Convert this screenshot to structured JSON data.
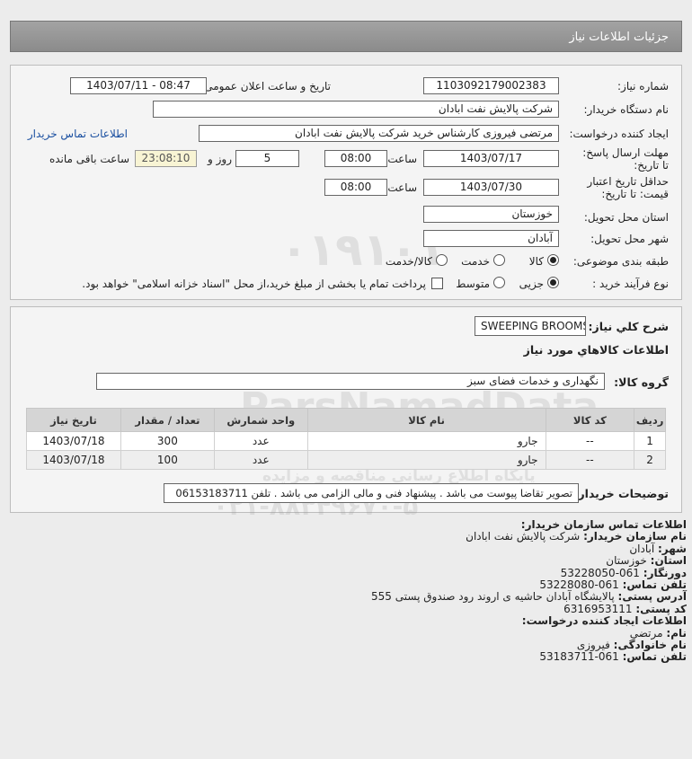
{
  "header": {
    "title": "جزئیات اطلاعات نیاز"
  },
  "form": {
    "need_number_label": "شماره نیاز:",
    "need_number": "1103092179002383",
    "announce_label": "تاریخ و ساعت اعلان عمومی:",
    "announce_value": "1403/07/11 - 08:47",
    "buyer_org_label": "نام دستگاه خریدار:",
    "buyer_org": "شرکت پالایش نفت ابادان",
    "creator_label": "ایجاد کننده درخواست:",
    "creator": "مرتضی فیروزی کارشناس خرید  شرکت پالایش نفت ابادان",
    "contact_link": "اطلاعات تماس خریدار",
    "deadline_label": "مهلت ارسال پاسخ: تا تاریخ:",
    "deadline_date": "1403/07/17",
    "time_label": "ساعت",
    "deadline_time": "08:00",
    "days": "5",
    "days_label": "روز و",
    "timer": "23:08:10",
    "remaining_label": "ساعت باقی مانده",
    "validity_label": "حداقل تاریخ اعتبار قیمت: تا تاریخ:",
    "validity_date": "1403/07/30",
    "validity_time": "08:00",
    "province_label": "استان محل تحویل:",
    "province": "خوزستان",
    "city_label": "شهر محل تحویل:",
    "city": "آبادان",
    "category_label": "طبقه بندی موضوعی:",
    "cat_goods": "کالا",
    "cat_service": "خدمت",
    "cat_both": "کالا/خدمت",
    "process_label": "نوع فرآیند خرید :",
    "proc_small": "جزیی",
    "proc_medium": "متوسط",
    "payment_note": "پرداخت تمام یا بخشی از مبلغ خرید،از محل \"اسناد خزانه اسلامی\" خواهد بود."
  },
  "details": {
    "general_desc_label": "شرح کلي نياز:",
    "general_desc": "SWEEPING BROOMS",
    "goods_info_title": "اطلاعات کالاهاي مورد نياز",
    "group_label": "گروه کالا:",
    "group_value": "نگهداری و خدمات فضای سبز",
    "table": {
      "headers": [
        "ردیف",
        "کد کالا",
        "نام کالا",
        "واحد شمارش",
        "تعداد / مقدار",
        "تاریخ نیاز"
      ],
      "rows": [
        [
          "1",
          "--",
          "جارو",
          "عدد",
          "300",
          "1403/07/18"
        ],
        [
          "2",
          "--",
          "جارو",
          "عدد",
          "100",
          "1403/07/18"
        ]
      ]
    },
    "buyer_notes_label": "توضیحات خریدار:",
    "buyer_notes": "تصویر تقاضا پیوست می باشد . پیشنهاد فنی و مالی الزامی می باشد . تلفن 06153183711"
  },
  "contact": {
    "title": "اطلاعات تماس سازمان خریدار:",
    "org_label": "نام سازمان خریدار:",
    "org": "شرکت پالایش نفت ابادان",
    "city_label": "شهر:",
    "city": "آبادان",
    "province_label": "استان:",
    "province": "خوزستان",
    "fax_label": "دورنگار:",
    "fax": "061-53228050",
    "phone_label": "تلفن تماس:",
    "phone": "061-53228080",
    "address_label": "آدرس پستی:",
    "address": "پالایشگاه آبادان حاشیه ی اروند رود صندوق پستی 555",
    "postal_label": "کد پستی:",
    "postal": "6316953111",
    "creator_title": "اطلاعات ایجاد کننده درخواست:",
    "name_label": "نام:",
    "name": "مرتضی",
    "family_label": "نام خانوادگی:",
    "family": "فیروزی",
    "creator_phone_label": "تلفن تماس:",
    "creator_phone": "061-53183711"
  },
  "watermark": {
    "brand": "ParsNamadData",
    "tagline": "مرکز فرآوری و ارائه اطلاعات پارس نماد داده ها",
    "subline": "پایگاه اطلاع رسانی مناقصه و مزایده",
    "phone": "۰۲۱-۸۸۳۴۹۶۷۰-۵",
    "number": "۰۱۹۱۰۱"
  }
}
